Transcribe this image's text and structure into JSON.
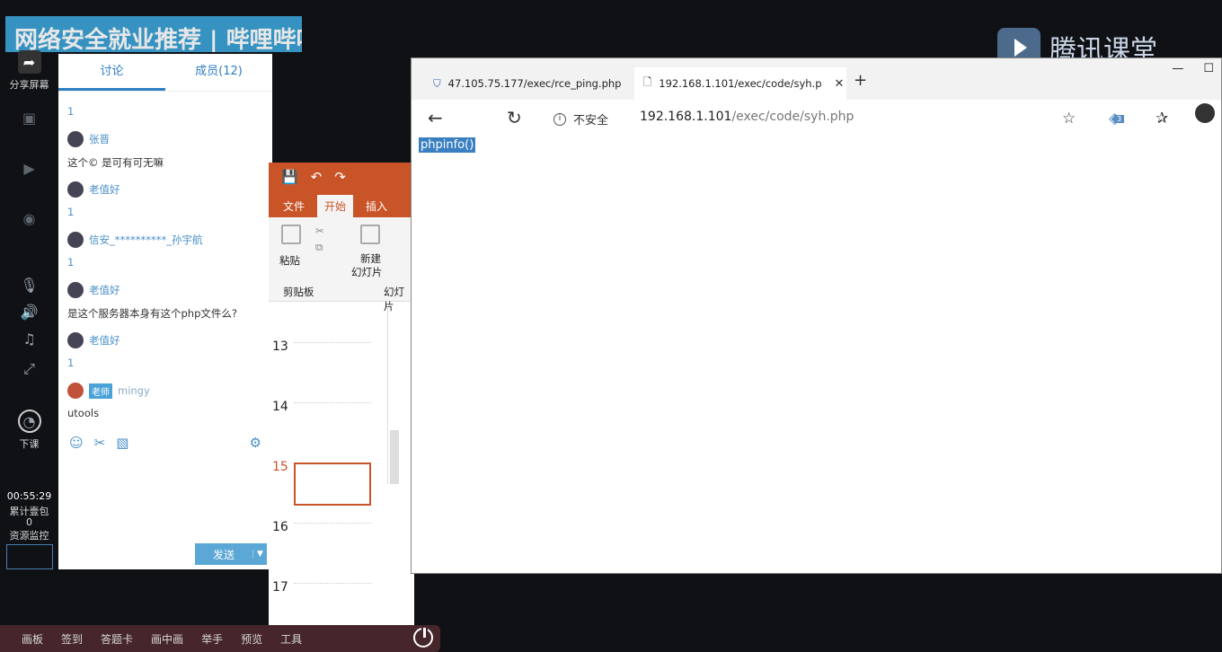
{
  "header": {
    "watermark_title": "网络安全就业推荐 | 哔哩哔哩",
    "brand_name": "腾讯课堂"
  },
  "left_toolbar": {
    "share_screen": "分享屏幕",
    "end_class": "下课",
    "timer": "00:55:29",
    "gift_label": "累计壹包",
    "gift_count": "0",
    "resource_monitor": "资源监控"
  },
  "chat": {
    "tabs": [
      {
        "label": "讨论",
        "active": true
      },
      {
        "label": "成员(12)",
        "active": false
      }
    ],
    "messages": [
      {
        "type": "num",
        "text": "1"
      },
      {
        "type": "user",
        "name": "张晋"
      },
      {
        "type": "text",
        "text": "这个© 是可有可无嘛"
      },
      {
        "type": "user",
        "name": "老值好"
      },
      {
        "type": "num",
        "text": "1"
      },
      {
        "type": "user",
        "name": "信安_**********_孙宇航"
      },
      {
        "type": "num",
        "text": "1"
      },
      {
        "type": "user",
        "name": "老值好"
      },
      {
        "type": "text",
        "text": "是这个服务器本身有这个php文件么?"
      },
      {
        "type": "user",
        "name": "老值好"
      },
      {
        "type": "num",
        "text": "1"
      },
      {
        "type": "teacher",
        "badge": "老师",
        "name": "mingy"
      },
      {
        "type": "text",
        "text": "utools"
      }
    ],
    "send_label": "发送"
  },
  "ppt": {
    "tabs": [
      "文件",
      "开始",
      "插入"
    ],
    "active_tab": "开始",
    "paste_label": "粘贴",
    "new_slide_label_1": "新建",
    "new_slide_label_2": "幻灯片",
    "clipboard_group": "剪贴板",
    "slides_group": "幻灯片",
    "slide_numbers": [
      "13",
      "14",
      "15",
      "16",
      "17"
    ],
    "selected_slide": "15"
  },
  "browser": {
    "tabs": [
      {
        "title": "47.105.75.177/exec/rce_ping.php",
        "active": false
      },
      {
        "title": "192.168.1.101/exec/code/syh.p",
        "active": true
      }
    ],
    "insecure_label": "不安全",
    "url_host": "192.168.1.101",
    "url_path": "/exec/code/syh.php",
    "page_text": "phpinfo()",
    "ext_badge_count": "3"
  },
  "taskbar": {
    "items": [
      "画板",
      "签到",
      "答题卡",
      "画中画",
      "举手",
      "预览",
      "工具"
    ]
  },
  "colors": {
    "ppt_accent": "#c85428",
    "chat_accent": "#2f7ec2",
    "taskbar_bg": "#46262a"
  }
}
